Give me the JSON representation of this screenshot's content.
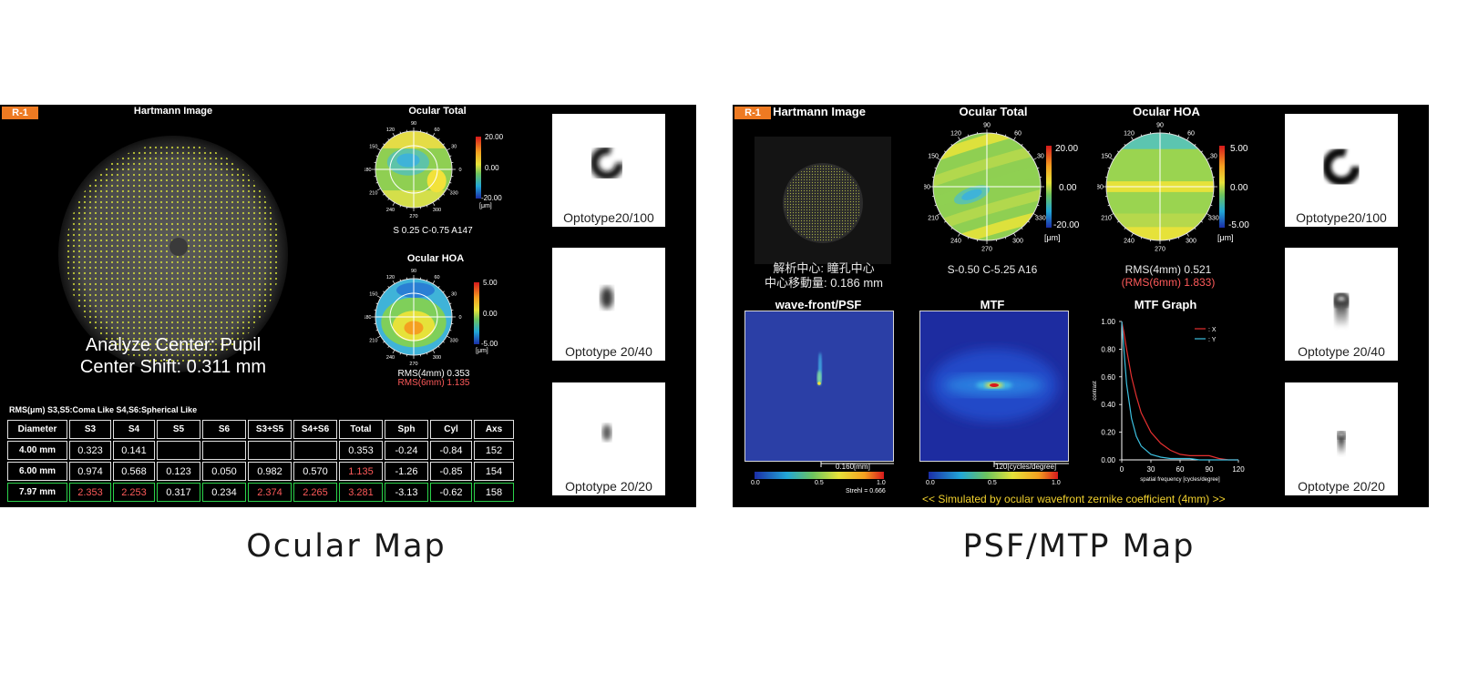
{
  "left": {
    "tag": "R-1",
    "hartmann_title": "Hartmann Image",
    "analyze_center": "Analyze Center: Pupil",
    "center_shift": "Center Shift:  0.311 mm",
    "ocular_total": {
      "title": "Ocular Total",
      "scale": [
        "20.00",
        "0.00",
        "-20.00",
        "[μm]"
      ],
      "result": "S 0.25 C-0.75 A147"
    },
    "ocular_hoa": {
      "title": "Ocular HOA",
      "scale": [
        "5.00",
        "0.00",
        "-5.00",
        "[μm]"
      ],
      "rms4": "RMS(4mm)  0.353",
      "rms6": "RMS(6mm)  1.135"
    },
    "rms_legend": "RMS(μm)   S3,S5:Coma Like   S4,S6:Spherical Like",
    "table": {
      "headers": [
        "Diameter",
        "S3",
        "S4",
        "S5",
        "S6",
        "S3+S5",
        "S4+S6",
        "Total",
        "Sph",
        "Cyl",
        "Axs"
      ],
      "rows": [
        [
          "4.00 mm",
          "0.323",
          "0.141",
          "",
          "",
          "",
          "",
          "0.353",
          "-0.24",
          "-0.84",
          "152"
        ],
        [
          "6.00 mm",
          "0.974",
          "0.568",
          "0.123",
          "0.050",
          "0.982",
          "0.570",
          "1.135",
          "-1.26",
          "-0.85",
          "154"
        ],
        [
          "7.97 mm",
          "2.353",
          "2.253",
          "0.317",
          "0.234",
          "2.374",
          "2.265",
          "3.281",
          "-3.13",
          "-0.62",
          "158"
        ]
      ]
    },
    "optotypes": [
      "Optotype20/100",
      "Optotype 20/40",
      "Optotype 20/20"
    ]
  },
  "right": {
    "tag": "R-1",
    "hartmann_title": "Hartmann Image",
    "jp_line1": "解析中心: 瞳孔中心",
    "jp_line2": "中心移動量:  0.186 mm",
    "ocular_total": {
      "title": "Ocular Total",
      "scale": [
        "20.00",
        "0.00",
        "-20.00",
        "[μm]"
      ],
      "result": "S-0.50 C-5.25 A16"
    },
    "ocular_hoa": {
      "title": "Ocular HOA",
      "scale": [
        "5.00",
        "0.00",
        "-5.00",
        "[μm]"
      ],
      "rms4": "RMS(4mm)  0.521",
      "rms6": "(RMS(6mm)  1.833)"
    },
    "psf": {
      "title": "wave-front/PSF",
      "scale_label": "0.160[mm]",
      "cb_ticks": [
        "0.0",
        "0.5",
        "1.0"
      ],
      "strehl": "Strehl = 0.666"
    },
    "mtf": {
      "title": "MTF",
      "scale_label": "120[cycles/degree]",
      "cb_ticks": [
        "0.0",
        "0.5",
        "1.0"
      ]
    },
    "optotypes": [
      "Optotype20/100",
      "Optotype 20/40",
      "Optotype 20/20"
    ],
    "bottom_note": "<< Simulated by ocular wavefront zernike coefficient (4mm) >>"
  },
  "chart_data": [
    {
      "type": "line",
      "title": "MTF Graph",
      "xlabel": "spatial frequency [cycles/degree]",
      "ylabel": "contrast",
      "xlim": [
        0,
        120
      ],
      "ylim": [
        0,
        1
      ],
      "x_ticks": [
        "0",
        "30",
        "60",
        "90",
        "120"
      ],
      "y_ticks": [
        "0.00",
        "0.20",
        "0.40",
        "0.60",
        "0.80",
        "1.00"
      ],
      "legend_position": "top-right",
      "series": [
        {
          "name": ": X",
          "color": "#e53030",
          "x": [
            0,
            2,
            5,
            10,
            15,
            20,
            30,
            40,
            50,
            60,
            70,
            80,
            90,
            100,
            110,
            120
          ],
          "y": [
            1.0,
            0.93,
            0.8,
            0.6,
            0.46,
            0.34,
            0.2,
            0.12,
            0.07,
            0.04,
            0.03,
            0.03,
            0.03,
            0.01,
            0.0,
            0.0
          ]
        },
        {
          "name": ": Y",
          "color": "#3cc0e0",
          "x": [
            0,
            2,
            5,
            10,
            15,
            20,
            30,
            40,
            50,
            60,
            70,
            80,
            90,
            100,
            110,
            120
          ],
          "y": [
            1.0,
            0.82,
            0.55,
            0.3,
            0.17,
            0.1,
            0.04,
            0.02,
            0.01,
            0.01,
            0.01,
            0.0,
            0.0,
            0.0,
            0.0,
            0.0
          ]
        }
      ]
    }
  ],
  "captions": {
    "left": "Ocular Map",
    "right": "PSF/MTP Map"
  },
  "angles": [
    "90",
    "60",
    "30",
    "0",
    "330",
    "300",
    "270",
    "240",
    "210",
    "180",
    "150",
    "120"
  ]
}
